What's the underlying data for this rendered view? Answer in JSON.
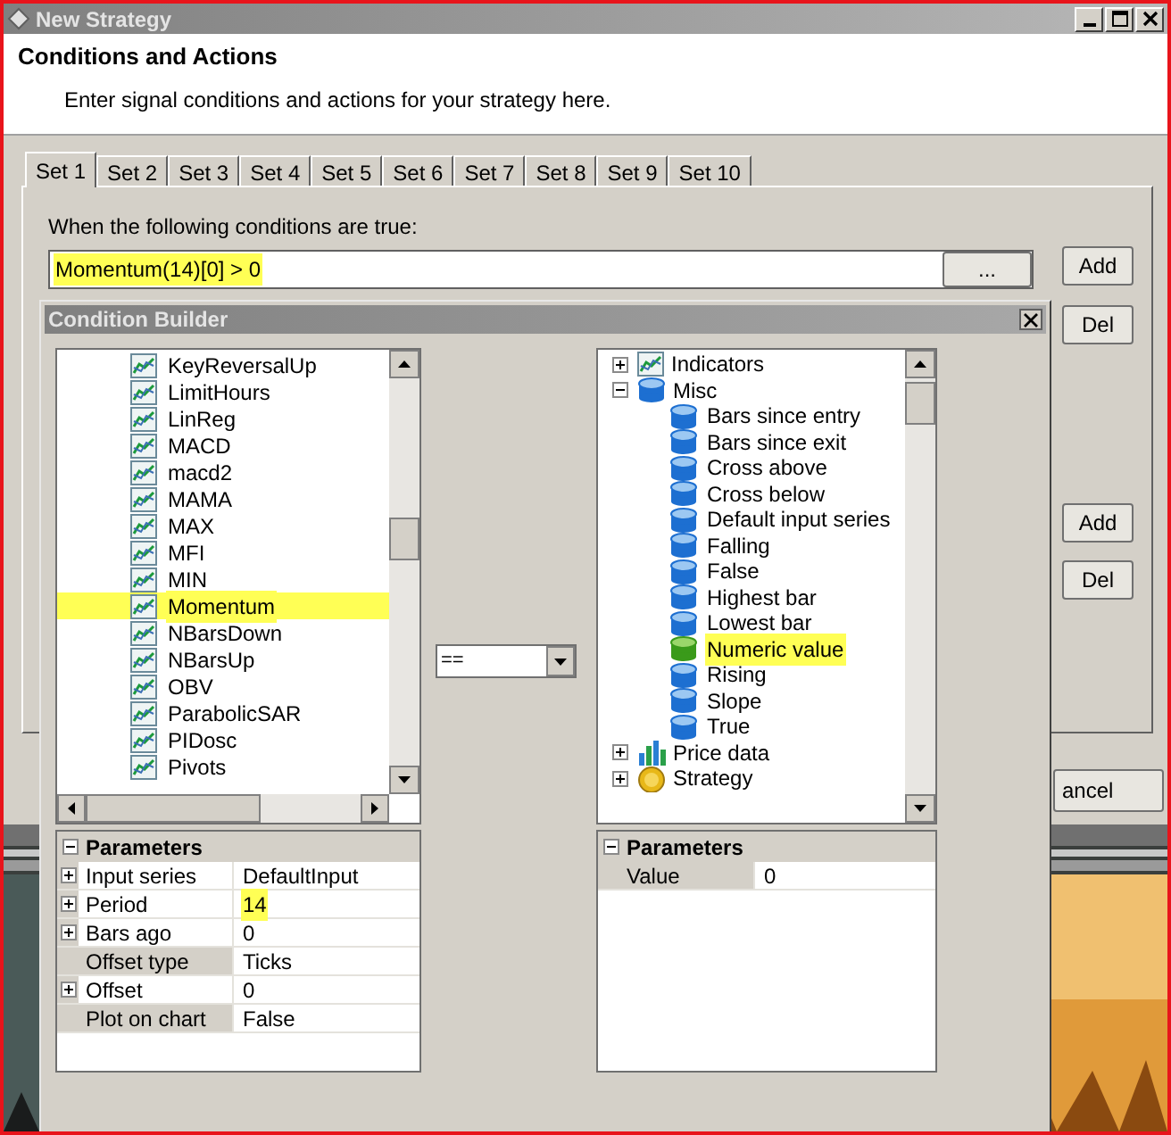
{
  "window": {
    "title": "New Strategy"
  },
  "header": {
    "title": "Conditions and Actions",
    "subtitle": "Enter signal conditions and actions for your strategy here."
  },
  "tabs": [
    {
      "label": "Set 1",
      "selected": true
    },
    {
      "label": "Set 2",
      "selected": false
    },
    {
      "label": "Set 3",
      "selected": false
    },
    {
      "label": "Set 4",
      "selected": false
    },
    {
      "label": "Set 5",
      "selected": false
    },
    {
      "label": "Set 6",
      "selected": false
    },
    {
      "label": "Set 7",
      "selected": false
    },
    {
      "label": "Set 8",
      "selected": false
    },
    {
      "label": "Set 9",
      "selected": false
    },
    {
      "label": "Set 10",
      "selected": false
    }
  ],
  "conditions": {
    "label": "When the following conditions are true:",
    "value": "Momentum(14)[0] > 0",
    "highlighted": true,
    "browse_button": "...",
    "add_button": "Add",
    "del_button": "Del"
  },
  "actions": {
    "add_button": "Add",
    "del_button": "Del"
  },
  "cancel_button": "ancel",
  "condition_builder": {
    "title": "Condition Builder",
    "left_list": [
      {
        "label": "KeyReversalUp",
        "selected": false
      },
      {
        "label": "LimitHours",
        "selected": false
      },
      {
        "label": "LinReg",
        "selected": false
      },
      {
        "label": "MACD",
        "selected": false
      },
      {
        "label": "macd2",
        "selected": false
      },
      {
        "label": "MAMA",
        "selected": false
      },
      {
        "label": "MAX",
        "selected": false
      },
      {
        "label": "MFI",
        "selected": false
      },
      {
        "label": "MIN",
        "selected": false
      },
      {
        "label": "Momentum",
        "selected": true
      },
      {
        "label": "NBarsDown",
        "selected": false
      },
      {
        "label": "NBarsUp",
        "selected": false
      },
      {
        "label": "OBV",
        "selected": false
      },
      {
        "label": "ParabolicSAR",
        "selected": false
      },
      {
        "label": "PIDosc",
        "selected": false
      },
      {
        "label": "Pivots",
        "selected": false
      }
    ],
    "operator": "==",
    "right_tree": [
      {
        "label": "Indicators",
        "kind": "chart",
        "expanded": false
      },
      {
        "label": "Misc",
        "kind": "cylinder",
        "expanded": true,
        "children": [
          {
            "label": "Bars since entry",
            "selected": false
          },
          {
            "label": "Bars since exit",
            "selected": false
          },
          {
            "label": "Cross above",
            "selected": false
          },
          {
            "label": "Cross below",
            "selected": false
          },
          {
            "label": "Default input series",
            "selected": false
          },
          {
            "label": "Falling",
            "selected": false
          },
          {
            "label": "False",
            "selected": false
          },
          {
            "label": "Highest bar",
            "selected": false
          },
          {
            "label": "Lowest bar",
            "selected": false
          },
          {
            "label": "Numeric value",
            "selected": true
          },
          {
            "label": "Rising",
            "selected": false
          },
          {
            "label": "Slope",
            "selected": false
          },
          {
            "label": "True",
            "selected": false
          }
        ]
      },
      {
        "label": "Price data",
        "kind": "bars",
        "expanded": false
      },
      {
        "label": "Strategy",
        "kind": "coin",
        "expanded": false
      }
    ],
    "left_parameters": {
      "title": "Parameters",
      "rows": [
        {
          "name": "Input series",
          "value": "DefaultInput",
          "expandable": true,
          "highlighted": false
        },
        {
          "name": "Period",
          "value": "14",
          "expandable": true,
          "highlighted": true
        },
        {
          "name": "Bars ago",
          "value": "0",
          "expandable": true,
          "highlighted": false
        },
        {
          "name": "Offset type",
          "value": "Ticks",
          "expandable": false,
          "highlighted": false
        },
        {
          "name": "Offset",
          "value": "0",
          "expandable": true,
          "highlighted": false
        },
        {
          "name": "Plot on chart",
          "value": "False",
          "expandable": false,
          "highlighted": false
        }
      ]
    },
    "right_parameters": {
      "title": "Parameters",
      "rows": [
        {
          "name": "Value",
          "value": "0",
          "expandable": false,
          "highlighted": false
        }
      ]
    }
  }
}
